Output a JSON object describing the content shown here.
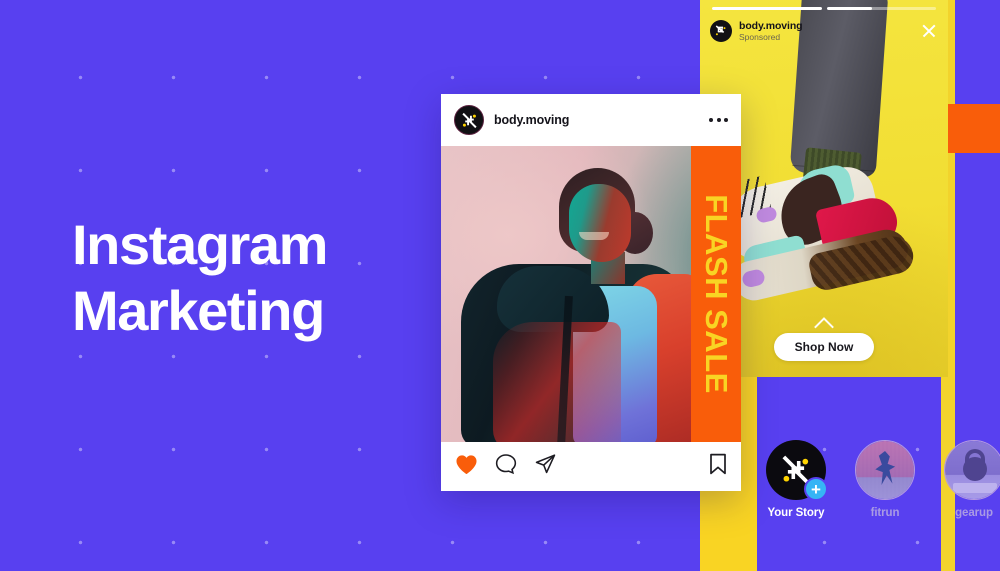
{
  "theme": {
    "background": "#5840f0",
    "accent_yellow": "#f9d423",
    "accent_orange": "#f95d0a",
    "story_blue": "#36b4f5",
    "heart_red": "#f95d0a"
  },
  "hero": {
    "line1": "Instagram",
    "line2": "Marketing"
  },
  "story_ad": {
    "username": "body.moving",
    "sponsored_label": "Sponsored",
    "cta_label": "Shop Now",
    "progress": [
      100,
      42
    ],
    "close_icon": "close-icon",
    "chevron_icon": "chevron-up-icon",
    "avatar_icon": "brand-arrow-logo"
  },
  "post": {
    "username": "body.moving",
    "more_icon": "more-options-icon",
    "overlay_text": "FLASH SALE",
    "actions": {
      "like_icon": "heart-icon",
      "comment_icon": "comment-icon",
      "share_icon": "share-paper-plane-icon",
      "save_icon": "bookmark-icon"
    }
  },
  "stories_tray": [
    {
      "label": "Your Story",
      "state": "own",
      "badge": "+",
      "icon": "brand-arrow-logo"
    },
    {
      "label": "fitrun",
      "state": "seen",
      "badge": "",
      "icon": "runner-thumbnail"
    },
    {
      "label": "gearup",
      "state": "seen",
      "badge": "",
      "icon": "kettlebell-thumbnail"
    }
  ]
}
